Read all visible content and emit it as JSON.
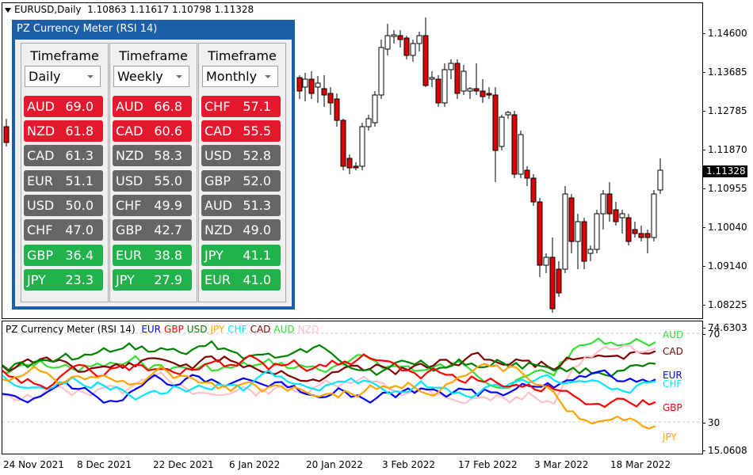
{
  "header": {
    "symbol": "EURUSD,Daily",
    "ohlc": "1.10863 1.11617 1.10798 1.11328"
  },
  "price_axis": [
    "1.14600",
    "1.13685",
    "1.12785",
    "1.11870",
    "1.10955",
    "1.10040",
    "1.09140",
    "1.08225"
  ],
  "current_price": "1.11328",
  "indicator": {
    "title": "PZ Currency Meter (RSI 14)",
    "legend": [
      {
        "name": "EUR",
        "color": "#0000ff"
      },
      {
        "name": "GBP",
        "color": "#ff0000"
      },
      {
        "name": "USD",
        "color": "#008000"
      },
      {
        "name": "JPY",
        "color": "#ffa500"
      },
      {
        "name": "CHF",
        "color": "#00e5ff"
      },
      {
        "name": "CAD",
        "color": "#800000"
      },
      {
        "name": "AUD",
        "color": "#33dd33"
      },
      {
        "name": "NZD",
        "color": "#ffc0cb"
      }
    ],
    "axis": [
      "74.6303",
      "70",
      "30",
      "15.0608"
    ],
    "end_labels": [
      {
        "name": "AUD",
        "color": "#33dd33"
      },
      {
        "name": "CAD",
        "color": "#800000"
      },
      {
        "name": "EUR",
        "color": "#0000ff"
      },
      {
        "name": "CHF",
        "color": "#00e5ff"
      },
      {
        "name": "GBP",
        "color": "#ff0000"
      },
      {
        "name": "JPY",
        "color": "#ffa500"
      }
    ]
  },
  "time_axis": [
    "24 Nov 2021",
    "8 Dec 2021",
    "22 Dec 2021",
    "6 Jan 2022",
    "20 Jan 2022",
    "3 Feb 2022",
    "17 Feb 2022",
    "3 Mar 2022",
    "18 Mar 2022"
  ],
  "panel": {
    "title": "PZ Currency Meter (RSI 14)",
    "columns": [
      {
        "header": "Timeframe",
        "selected": "Daily",
        "rows": [
          {
            "ccy": "AUD",
            "val": "69.0",
            "status": "red"
          },
          {
            "ccy": "NZD",
            "val": "61.8",
            "status": "red"
          },
          {
            "ccy": "CAD",
            "val": "61.3",
            "status": "grey"
          },
          {
            "ccy": "EUR",
            "val": "51.1",
            "status": "grey"
          },
          {
            "ccy": "USD",
            "val": "50.0",
            "status": "grey"
          },
          {
            "ccy": "CHF",
            "val": "47.0",
            "status": "grey"
          },
          {
            "ccy": "GBP",
            "val": "36.4",
            "status": "green"
          },
          {
            "ccy": "JPY",
            "val": "23.3",
            "status": "green"
          }
        ]
      },
      {
        "header": "Timeframe",
        "selected": "Weekly",
        "rows": [
          {
            "ccy": "AUD",
            "val": "66.8",
            "status": "red"
          },
          {
            "ccy": "CAD",
            "val": "60.6",
            "status": "red"
          },
          {
            "ccy": "NZD",
            "val": "58.3",
            "status": "grey"
          },
          {
            "ccy": "USD",
            "val": "55.0",
            "status": "grey"
          },
          {
            "ccy": "CHF",
            "val": "49.9",
            "status": "grey"
          },
          {
            "ccy": "GBP",
            "val": "42.7",
            "status": "grey"
          },
          {
            "ccy": "EUR",
            "val": "38.8",
            "status": "green"
          },
          {
            "ccy": "JPY",
            "val": "27.9",
            "status": "green"
          }
        ]
      },
      {
        "header": "Timeframe",
        "selected": "Monthly",
        "rows": [
          {
            "ccy": "CHF",
            "val": "57.1",
            "status": "red"
          },
          {
            "ccy": "CAD",
            "val": "55.5",
            "status": "red"
          },
          {
            "ccy": "USD",
            "val": "52.8",
            "status": "grey"
          },
          {
            "ccy": "GBP",
            "val": "52.0",
            "status": "grey"
          },
          {
            "ccy": "AUD",
            "val": "51.3",
            "status": "grey"
          },
          {
            "ccy": "NZD",
            "val": "49.0",
            "status": "grey"
          },
          {
            "ccy": "JPY",
            "val": "41.1",
            "status": "green"
          },
          {
            "ccy": "EUR",
            "val": "41.0",
            "status": "green"
          }
        ]
      }
    ]
  }
}
